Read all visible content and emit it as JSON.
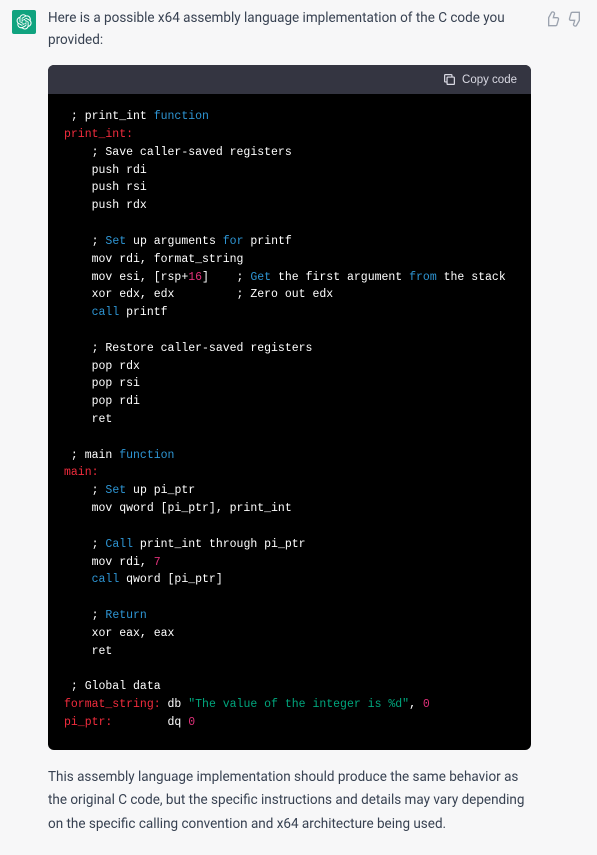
{
  "intro": "Here is a possible x64 assembly language implementation of the C code you provided:",
  "outro": "This assembly language implementation should produce the same behavior as the original C code, but the specific instructions and details may vary depending on the specific calling convention and x64 architecture being used.",
  "copy_label": "Copy code",
  "code": {
    "lines": [
      [
        {
          "t": " ; print_int ",
          "c": "white"
        },
        {
          "t": "function",
          "c": "keyword"
        }
      ],
      [
        {
          "t": "print_int:",
          "c": "label"
        }
      ],
      [
        {
          "t": "    ; Save caller-saved registers",
          "c": "white"
        }
      ],
      [
        {
          "t": "    push rdi",
          "c": "white"
        }
      ],
      [
        {
          "t": "    push rsi",
          "c": "white"
        }
      ],
      [
        {
          "t": "    push rdx",
          "c": "white"
        }
      ],
      [
        {
          "t": "",
          "c": "white"
        }
      ],
      [
        {
          "t": "    ; ",
          "c": "white"
        },
        {
          "t": "Set",
          "c": "keyword"
        },
        {
          "t": " up arguments ",
          "c": "white"
        },
        {
          "t": "for",
          "c": "keyword"
        },
        {
          "t": " printf",
          "c": "white"
        }
      ],
      [
        {
          "t": "    mov rdi, format_string",
          "c": "white"
        }
      ],
      [
        {
          "t": "    mov esi, [rsp+",
          "c": "white"
        },
        {
          "t": "16",
          "c": "number"
        },
        {
          "t": "]    ; ",
          "c": "white"
        },
        {
          "t": "Get",
          "c": "keyword"
        },
        {
          "t": " the first argument ",
          "c": "white"
        },
        {
          "t": "from",
          "c": "keyword"
        },
        {
          "t": " the stack",
          "c": "white"
        }
      ],
      [
        {
          "t": "    xor edx, edx         ; Zero out edx",
          "c": "white"
        }
      ],
      [
        {
          "t": "    ",
          "c": "white"
        },
        {
          "t": "call",
          "c": "keyword"
        },
        {
          "t": " printf",
          "c": "white"
        }
      ],
      [
        {
          "t": "",
          "c": "white"
        }
      ],
      [
        {
          "t": "    ; Restore caller-saved registers",
          "c": "white"
        }
      ],
      [
        {
          "t": "    pop rdx",
          "c": "white"
        }
      ],
      [
        {
          "t": "    pop rsi",
          "c": "white"
        }
      ],
      [
        {
          "t": "    pop rdi",
          "c": "white"
        }
      ],
      [
        {
          "t": "    ret",
          "c": "white"
        }
      ],
      [
        {
          "t": "",
          "c": "white"
        }
      ],
      [
        {
          "t": " ; main ",
          "c": "white"
        },
        {
          "t": "function",
          "c": "keyword"
        }
      ],
      [
        {
          "t": "main:",
          "c": "label"
        }
      ],
      [
        {
          "t": "    ; ",
          "c": "white"
        },
        {
          "t": "Set",
          "c": "keyword"
        },
        {
          "t": " up pi_ptr",
          "c": "white"
        }
      ],
      [
        {
          "t": "    mov qword [pi_ptr], print_int",
          "c": "white"
        }
      ],
      [
        {
          "t": "",
          "c": "white"
        }
      ],
      [
        {
          "t": "    ; ",
          "c": "white"
        },
        {
          "t": "Call",
          "c": "keyword"
        },
        {
          "t": " print_int through pi_ptr",
          "c": "white"
        }
      ],
      [
        {
          "t": "    mov rdi, ",
          "c": "white"
        },
        {
          "t": "7",
          "c": "number"
        }
      ],
      [
        {
          "t": "    ",
          "c": "white"
        },
        {
          "t": "call",
          "c": "keyword"
        },
        {
          "t": " qword [pi_ptr]",
          "c": "white"
        }
      ],
      [
        {
          "t": "",
          "c": "white"
        }
      ],
      [
        {
          "t": "    ; ",
          "c": "white"
        },
        {
          "t": "Return",
          "c": "keyword"
        }
      ],
      [
        {
          "t": "    xor eax, eax",
          "c": "white"
        }
      ],
      [
        {
          "t": "    ret",
          "c": "white"
        }
      ],
      [
        {
          "t": "",
          "c": "white"
        }
      ],
      [
        {
          "t": " ; Global data",
          "c": "white"
        }
      ],
      [
        {
          "t": "format_string:",
          "c": "label"
        },
        {
          "t": " db ",
          "c": "white"
        },
        {
          "t": "\"The value of the integer is %d\"",
          "c": "string"
        },
        {
          "t": ", ",
          "c": "white"
        },
        {
          "t": "0",
          "c": "number"
        }
      ],
      [
        {
          "t": "pi_ptr:",
          "c": "label"
        },
        {
          "t": "        dq ",
          "c": "white"
        },
        {
          "t": "0",
          "c": "number"
        }
      ]
    ]
  }
}
